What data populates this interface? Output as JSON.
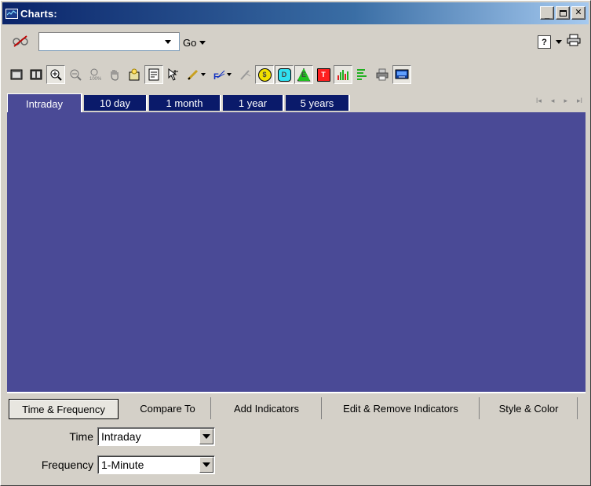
{
  "window": {
    "title": "Charts:",
    "controls": {
      "minimize": "_",
      "maximize": "□",
      "close": "✕"
    }
  },
  "symbol_bar": {
    "symbol_value": "",
    "go_label": "Go",
    "icons": [
      "glasses-icon",
      "help-icon",
      "print-icon"
    ],
    "help_glyph": "?"
  },
  "toolbar": {
    "icons": [
      "single-chart-icon",
      "multi-chart-icon",
      "zoom-in-icon",
      "zoom-out-icon",
      "zoom-100-icon",
      "pan-hand-icon",
      "crosshair-icon",
      "notes-icon",
      "select-pointer-icon",
      "pencil-icon",
      "fibonacci-icon",
      "erase-icon",
      "dividends-icon",
      "d-icon",
      "earnings-icon",
      "t-icon",
      "volume-bars-icon",
      "price-levels-icon",
      "print-chart-icon",
      "screen-icon"
    ],
    "badges": {
      "dividends": "$",
      "d": "D",
      "earnings": "E",
      "t": "T"
    }
  },
  "period_tabs": [
    {
      "label": "Intraday",
      "active": true
    },
    {
      "label": "10 day",
      "active": false
    },
    {
      "label": "1 month",
      "active": false
    },
    {
      "label": "1 year",
      "active": false
    },
    {
      "label": "5 years",
      "active": false
    }
  ],
  "bottom_tabs": [
    {
      "label": "Time & Frequency",
      "active": true
    },
    {
      "label": "Compare To",
      "active": false
    },
    {
      "label": "Add Indicators",
      "active": false
    },
    {
      "label": "Edit & Remove Indicators",
      "active": false
    },
    {
      "label": "Style & Color",
      "active": false
    }
  ],
  "settings": {
    "time_label": "Time",
    "time_value": "Intraday",
    "frequency_label": "Frequency",
    "frequency_value": "1-Minute"
  },
  "colors": {
    "chart_background": "#4a4a96",
    "title_gradient_start": "#0a246a",
    "inactive_tab": "#0a1a6a",
    "window_face": "#d4d0c8"
  }
}
